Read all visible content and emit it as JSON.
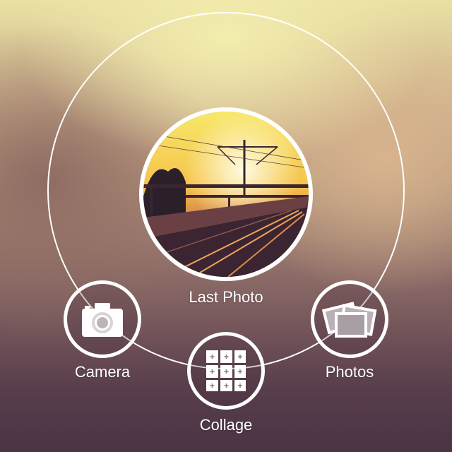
{
  "menu": {
    "last_photo": {
      "label": "Last Photo",
      "icon": "railway-sunset-thumbnail"
    },
    "camera": {
      "label": "Camera",
      "icon": "camera-icon"
    },
    "collage": {
      "label": "Collage",
      "icon": "collage-grid-icon"
    },
    "photos": {
      "label": "Photos",
      "icon": "photos-stack-icon"
    }
  },
  "colors": {
    "ring": "#ffffff",
    "sky_top": "#f3edae",
    "sky_bottom": "#4a3344"
  }
}
